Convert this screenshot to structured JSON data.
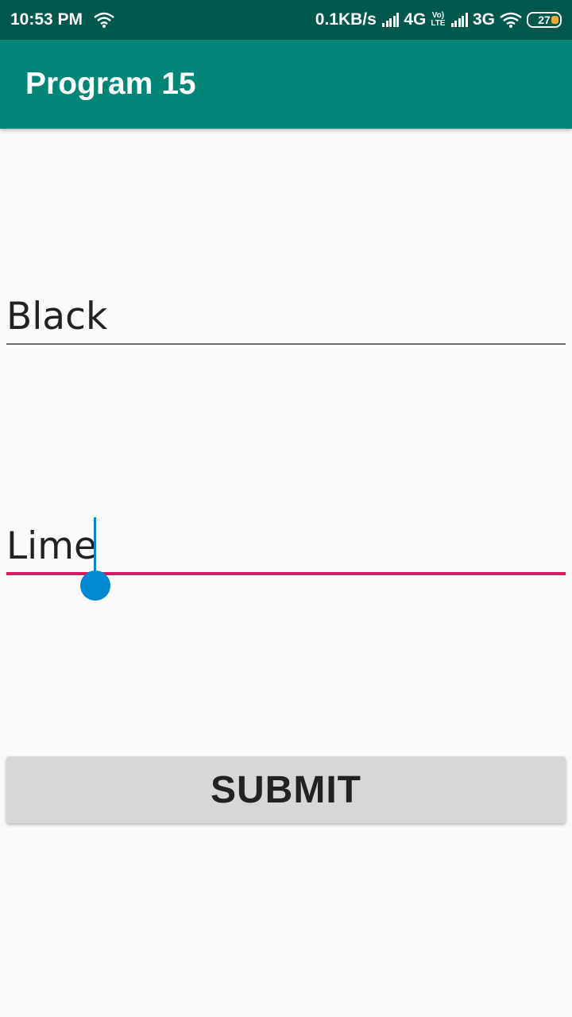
{
  "status_bar": {
    "time": "10:53 PM",
    "net_speed": "0.1KB/s",
    "network_1": "4G",
    "volte_top": "Vo)",
    "volte_bottom": "LTE",
    "network_2": "3G",
    "battery": "27",
    "icons": [
      "wifi-icon",
      "signal-icon",
      "signal-icon",
      "wifi-icon",
      "battery-icon"
    ],
    "battery_color": "#f2a93b"
  },
  "app_bar": {
    "title": "Program 15",
    "color": "#008577"
  },
  "form": {
    "field1_value": "Black",
    "field2_value": "Lime",
    "submit_label": "SUBMIT",
    "focus_underline_color": "#d81b60",
    "cursor_color": "#0288d1"
  }
}
